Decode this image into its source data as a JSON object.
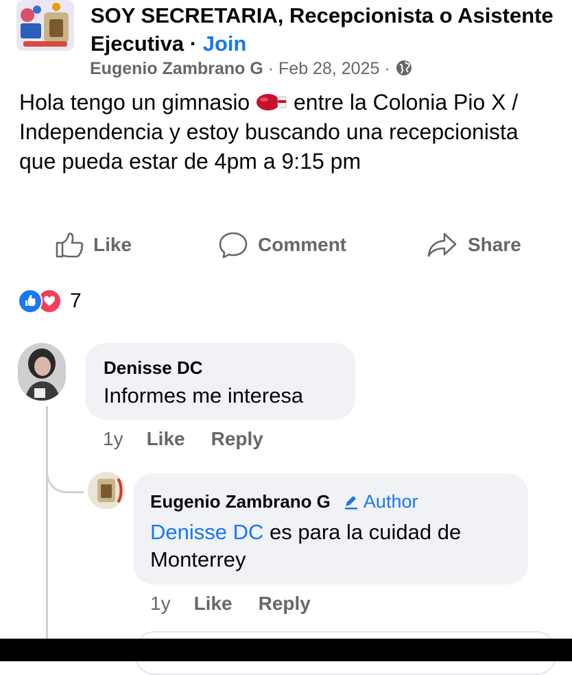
{
  "post": {
    "group_name": "SOY SECRETARIA, Recepcionista o Asistente Ejecutiva",
    "separator": "·",
    "join_label": "Join",
    "author": "Eugenio Zambrano G",
    "date": "Feb 28, 2025",
    "privacy_icon": "globe-icon",
    "text_part1": "Hola tengo un gimnasio",
    "text_emoji": "boxing-glove-emoji",
    "text_part2": "entre la Colonia Pio X / Independencia y estoy buscando una recepcionista que pueda estar de 4pm a 9:15 pm"
  },
  "actions": {
    "like": "Like",
    "comment": "Comment",
    "share": "Share"
  },
  "reactions": {
    "count": "7",
    "types": [
      "like",
      "love"
    ]
  },
  "comments": [
    {
      "name": "Denisse DC",
      "text": "Informes me interesa",
      "time": "1y",
      "like": "Like",
      "reply": "Reply"
    },
    {
      "name": "Eugenio Zambrano G",
      "badge": "Author",
      "mention": "Denisse DC",
      "text": "es para la cuidad de Monterrey",
      "time": "1y",
      "like": "Like",
      "reply": "Reply"
    }
  ],
  "colors": {
    "accent": "#1877f2",
    "secondary_text": "#65676b",
    "bubble": "#f0f2f5",
    "love": "#f33e58"
  }
}
